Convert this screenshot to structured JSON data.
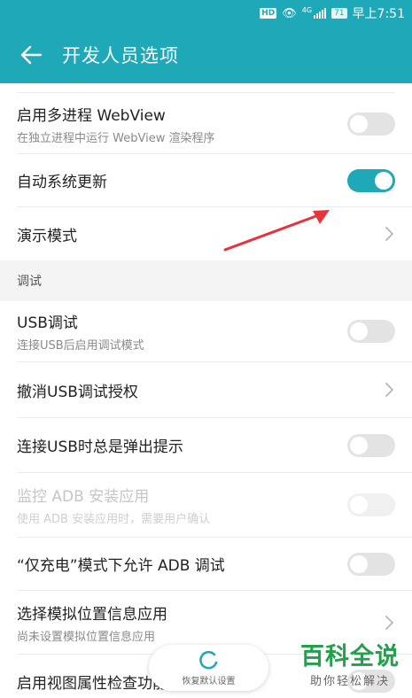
{
  "status_bar": {
    "hd_badge": "HD",
    "network": "4G",
    "battery": "71",
    "time": "早上7:51"
  },
  "app_bar": {
    "title": "开发人员选项"
  },
  "rows": [
    {
      "label": "启用多进程 WebView",
      "sub": "在独立进程中运行 WebView 渲染程序",
      "control": "toggle",
      "on": false
    },
    {
      "label": "自动系统更新",
      "control": "toggle",
      "on": true
    },
    {
      "label": "演示模式",
      "control": "chevron"
    }
  ],
  "section_debug": {
    "label": "调试"
  },
  "debug_rows": [
    {
      "label": "USB调试",
      "sub": "连接USB后启用调试模式",
      "control": "toggle",
      "on": false
    },
    {
      "label": "撤消USB调试授权",
      "control": "chevron"
    },
    {
      "label": "连接USB时总是弹出提示",
      "control": "toggle",
      "on": false
    },
    {
      "label": "监控 ADB 安装应用",
      "sub": "使用 ADB 安装应用时，需要用户确认",
      "control": "toggle",
      "on": false,
      "disabled": true
    },
    {
      "label": "“仅充电”模式下允许 ADB 调试",
      "control": "toggle",
      "on": false
    },
    {
      "label": "选择模拟位置信息应用",
      "sub": "尚未设置模拟位置信息应用",
      "control": "chevron"
    },
    {
      "label": "启用视图属性检查功能",
      "control": "toggle",
      "on": false
    }
  ],
  "restore_button": {
    "label": "恢复默认设置"
  },
  "watermark": {
    "main": "百科全说",
    "sub": "助你轻松解决"
  },
  "colors": {
    "accent": "#1fa8b8",
    "arrow": "#e8333a",
    "watermark": "#22a04b"
  }
}
